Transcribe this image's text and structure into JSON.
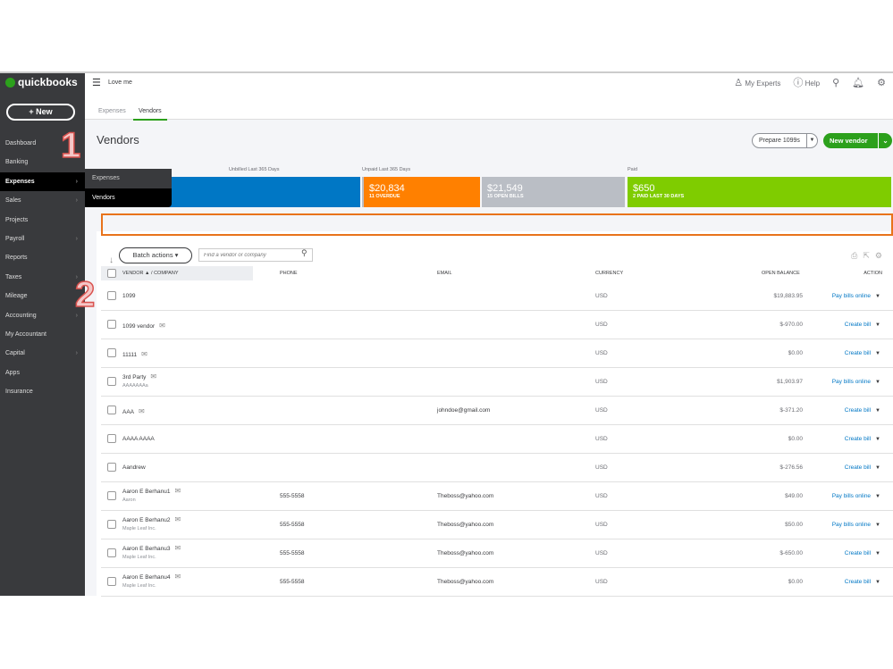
{
  "app": {
    "logo_small": "intuit",
    "logo": "quickbooks",
    "company": "Love me",
    "new_label": "New"
  },
  "header": {
    "my_experts": "My Experts",
    "help": "Help"
  },
  "sidebar": {
    "items": [
      {
        "label": "Dashboard"
      },
      {
        "label": "Banking"
      },
      {
        "label": "Expenses",
        "active": true,
        "chevron": true
      },
      {
        "label": "Sales",
        "chevron": true
      },
      {
        "label": "Projects"
      },
      {
        "label": "Payroll",
        "chevron": true
      },
      {
        "label": "Reports"
      },
      {
        "label": "Taxes",
        "chevron": true
      },
      {
        "label": "Mileage"
      },
      {
        "label": "Accounting",
        "chevron": true
      },
      {
        "label": "My Accountant"
      },
      {
        "label": "Capital",
        "chevron": true
      },
      {
        "label": "Apps"
      },
      {
        "label": "Insurance"
      }
    ]
  },
  "flyout": {
    "items": [
      "Expenses",
      "Vendors"
    ]
  },
  "tabs": [
    {
      "label": "Expenses"
    },
    {
      "label": "Vendors",
      "active": true
    }
  ],
  "page": {
    "title": "Vendors",
    "prepare": "Prepare 1099s",
    "new_vendor": "New vendor"
  },
  "money_bar": {
    "unbilled_label": "Unbilled Last 365 Days",
    "unpaid_label": "Unpaid Last 365 Days",
    "paid_label": "Paid",
    "overdue_amount": "$20,834",
    "overdue_sub": "11 OVERDUE",
    "open_amount": "$21,549",
    "open_sub": "15 OPEN BILLS",
    "paid_amount": "$650",
    "paid_sub": "2 PAID LAST 30 DAYS",
    "colors": {
      "unbilled": "#0077c5",
      "overdue": "#ff8000",
      "open": "#babec5",
      "paid": "#7fcc00"
    }
  },
  "table": {
    "batch": "Batch actions",
    "search_placeholder": "Find a vendor or company",
    "headers": {
      "vendor": "VENDOR ▲ / COMPANY",
      "phone": "PHONE",
      "email": "EMAIL",
      "currency": "CURRENCY",
      "balance": "OPEN BALANCE",
      "action": "ACTION"
    },
    "rows": [
      {
        "name": "1099",
        "company": "",
        "mail": false,
        "phone": "",
        "email": "",
        "currency": "USD",
        "balance": "$19,883.95",
        "action": "Pay bills online"
      },
      {
        "name": "1099 vendor",
        "company": "",
        "mail": true,
        "phone": "",
        "email": "",
        "currency": "USD",
        "balance": "$-970.00",
        "action": "Create bill"
      },
      {
        "name": "11111",
        "company": "",
        "mail": true,
        "phone": "",
        "email": "",
        "currency": "USD",
        "balance": "$0.00",
        "action": "Create bill"
      },
      {
        "name": "3rd Party",
        "company": "AAAAAAAa",
        "mail": true,
        "phone": "",
        "email": "",
        "currency": "USD",
        "balance": "$1,903.97",
        "action": "Pay bills online"
      },
      {
        "name": "AAA",
        "company": "",
        "mail": true,
        "phone": "",
        "email": "johndoe@gmail.com",
        "currency": "USD",
        "balance": "$-371.20",
        "action": "Create bill"
      },
      {
        "name": "AAAA AAAA",
        "company": "",
        "mail": false,
        "phone": "",
        "email": "",
        "currency": "USD",
        "balance": "$0.00",
        "action": "Create bill"
      },
      {
        "name": "Aandrew",
        "company": "",
        "mail": false,
        "phone": "",
        "email": "",
        "currency": "USD",
        "balance": "$-276.56",
        "action": "Create bill"
      },
      {
        "name": "Aaron E Berhanu1",
        "company": "Aaron",
        "mail": true,
        "phone": "555-5558",
        "email": "Theboss@yahoo.com",
        "currency": "USD",
        "balance": "$49.00",
        "action": "Pay bills online"
      },
      {
        "name": "Aaron E Berhanu2",
        "company": "Maple Leaf Inc.",
        "mail": true,
        "phone": "555-5558",
        "email": "Theboss@yahoo.com",
        "currency": "USD",
        "balance": "$50.00",
        "action": "Pay bills online"
      },
      {
        "name": "Aaron E Berhanu3",
        "company": "Maple Leaf Inc.",
        "mail": true,
        "phone": "555-5558",
        "email": "Theboss@yahoo.com",
        "currency": "USD",
        "balance": "$-650.00",
        "action": "Create bill"
      },
      {
        "name": "Aaron E Berhanu4",
        "company": "Maple Leaf Inc.",
        "mail": true,
        "phone": "555-5558",
        "email": "Theboss@yahoo.com",
        "currency": "USD",
        "balance": "$0.00",
        "action": "Create bill"
      }
    ]
  },
  "annotations": [
    "1",
    "2"
  ]
}
